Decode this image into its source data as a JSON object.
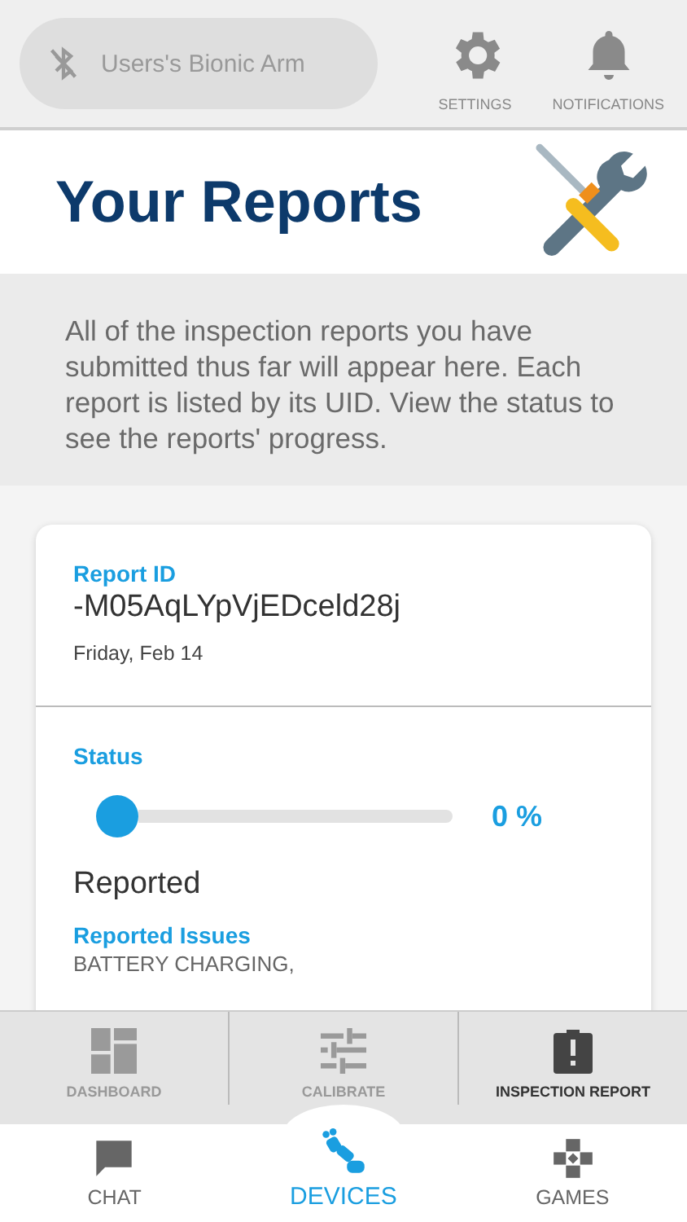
{
  "header": {
    "device": {
      "name": "Users's Bionic Arm",
      "connected": false
    },
    "actions": [
      {
        "label": "SETTINGS",
        "kind": "settings"
      },
      {
        "label": "NOTIFICATIONS",
        "kind": "notifications"
      }
    ]
  },
  "title": "Your Reports",
  "description": "All of the inspection reports you have submitted thus far will appear here. Each report is listed by its UID. View the status to see the reports' progress.",
  "report": {
    "id_label": "Report ID",
    "id": "-M05AqLYpVjEDceld28j",
    "date": "Friday, Feb 14",
    "status_label": "Status",
    "level": 0,
    "percent": "0 %",
    "status": "Reported",
    "issues_label": "Reported Issues",
    "issues": "BATTERY CHARGING,"
  },
  "sub_tabs": [
    {
      "label": "DASHBOARD",
      "kind": "dashboard",
      "selected": false
    },
    {
      "label": "CALIBRATE",
      "kind": "calibrate",
      "selected": false
    },
    {
      "label": "INSPECTION REPORT",
      "kind": "report",
      "selected": true
    }
  ],
  "nav": [
    {
      "label": "CHAT",
      "kind": "chat",
      "selected": false
    },
    {
      "label": "DEVICES",
      "kind": "devices",
      "selected": true
    },
    {
      "label": "GAMES",
      "kind": "games",
      "selected": false
    }
  ]
}
